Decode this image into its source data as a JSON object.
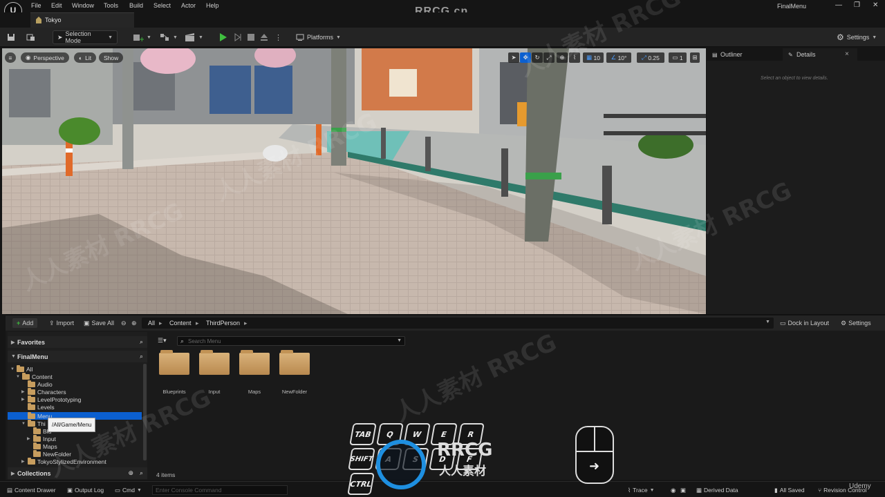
{
  "menubar": {
    "logo": "U",
    "items": [
      "File",
      "Edit",
      "Window",
      "Tools",
      "Build",
      "Select",
      "Actor",
      "Help"
    ],
    "project_name": "FinalMenu",
    "window_controls": [
      "—",
      "❐",
      "✕"
    ]
  },
  "tab": {
    "label": "Tokyo"
  },
  "watermark_top": "RRCG.cn",
  "toolbar": {
    "selection_mode": "Selection Mode",
    "platforms": "Platforms",
    "settings": "Settings"
  },
  "viewport": {
    "perspective": "Perspective",
    "lit": "Lit",
    "show": "Show",
    "grid_snap": "10",
    "rotation_snap": "10°",
    "scale_snap": "0.25",
    "camera_speed": "1"
  },
  "right_panel": {
    "outliner_tab": "Outliner",
    "details_tab": "Details",
    "close": "×",
    "empty_message": "Select an object to view details."
  },
  "content_browser": {
    "add": "Add",
    "import": "Import",
    "save_all": "Save All",
    "breadcrumb": [
      "All",
      "Content",
      "ThirdPerson"
    ],
    "dock_in_layout": "Dock in Layout",
    "settings": "Settings",
    "favorites": "Favorites",
    "project_section": "FinalMenu",
    "collections": "Collections",
    "search_placeholder": "Search Menu",
    "tooltip": "/All/Game/Menu",
    "items_count": "4 items",
    "tree": [
      "All",
      "Content",
      "Audio",
      "Characters",
      "LevelPrototyping",
      "Levels",
      "Menu",
      "Thi",
      "Blu",
      "Input",
      "Maps",
      "NewFolder",
      "TokyoStylizedEnvironment"
    ],
    "folders": [
      "Blueprints",
      "Input",
      "Maps",
      "NewFolder"
    ]
  },
  "statusbar": {
    "content_drawer": "Content Drawer",
    "output_log": "Output Log",
    "cmd": "Cmd",
    "console_placeholder": "Enter Console Command",
    "trace": "Trace",
    "derived_data": "Derived Data",
    "all_saved": "All Saved",
    "revision_control": "Revision Control"
  },
  "overlay": {
    "keys": [
      "TAB",
      "Q",
      "W",
      "E",
      "R",
      "SHIFT",
      "A",
      "S",
      "D",
      "F",
      "CTRL"
    ],
    "watermark_logo": "RRCG",
    "watermark_sub": "人人素材",
    "watermark_bg": "人人素材 RRCG",
    "udemy": "Udemy"
  },
  "colors": {
    "accent": "#0b5fcf",
    "play": "#3fbf3f",
    "folder": "#c79d5e"
  }
}
